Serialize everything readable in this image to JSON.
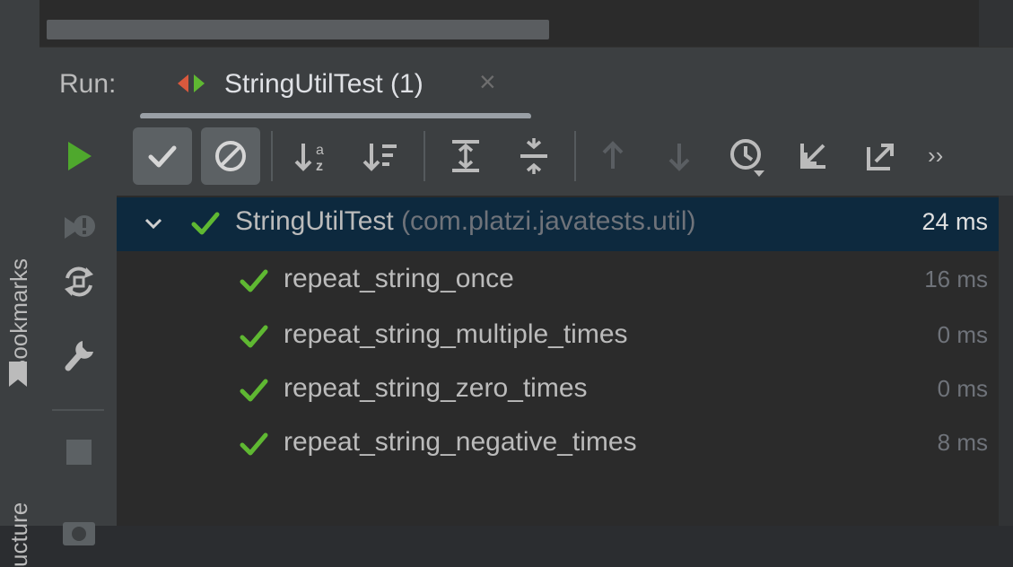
{
  "sidebar": {
    "bookmarks_label": "Bookmarks",
    "structure_label": "ucture"
  },
  "run_window": {
    "title": "Run:",
    "tab": {
      "label": "StringUtilTest (1)",
      "close_glyph": "×"
    }
  },
  "icons": {
    "run": "run-icon",
    "rerun_failed": "rerun-failed-icon",
    "toggle_auto_test": "toggle-auto-test-icon",
    "settings": "wrench-icon",
    "stop": "stop-icon",
    "show_passed": "check-icon",
    "show_ignored": "ignored-icon",
    "sort_alpha": "sort-alphabetically-icon",
    "sort_duration": "sort-by-duration-icon",
    "expand_all": "expand-all-icon",
    "collapse_all": "collapse-all-icon",
    "prev_failed": "arrow-up-icon",
    "next_failed": "arrow-down-icon",
    "history": "test-history-icon",
    "import": "import-tests-icon",
    "export": "export-tests-icon",
    "more": "more-chevrons-icon"
  },
  "toolbar": {
    "more_glyph": "››"
  },
  "colors": {
    "pass_green": "#5fb832",
    "selection": "#0d293e",
    "panel": "#3c3f41",
    "background": "#2b2b2b"
  },
  "test_tree": {
    "root": {
      "name": "StringUtilTest",
      "package": "(com.platzi.javatests.util)",
      "duration": "24 ms",
      "status": "passed"
    },
    "tests": [
      {
        "name": "repeat_string_once",
        "duration": "16 ms",
        "status": "passed"
      },
      {
        "name": "repeat_string_multiple_times",
        "duration": "0 ms",
        "status": "passed"
      },
      {
        "name": "repeat_string_zero_times",
        "duration": "0 ms",
        "status": "passed"
      },
      {
        "name": "repeat_string_negative_times",
        "duration": "8 ms",
        "status": "passed"
      }
    ]
  }
}
